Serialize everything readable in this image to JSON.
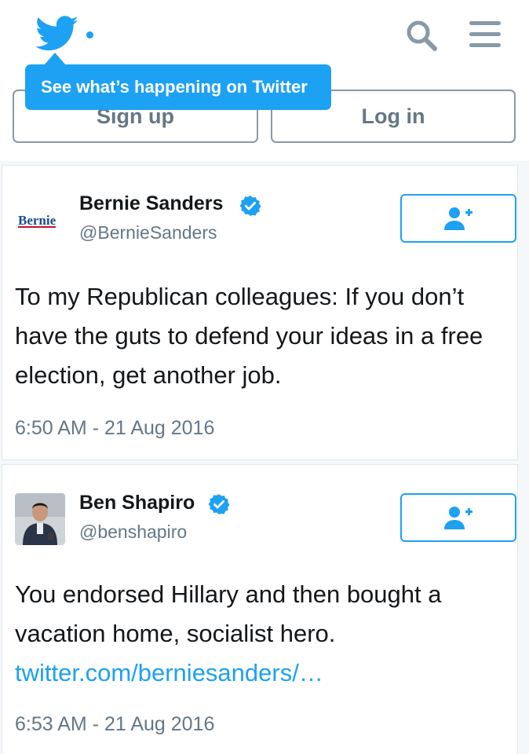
{
  "header": {
    "logo_icon": "twitter-bird-icon",
    "search_icon": "search-icon",
    "menu_icon": "hamburger-menu-icon",
    "accent_color": "#1da1f2"
  },
  "tooltip": {
    "text": "See what’s happening on Twitter"
  },
  "auth": {
    "signup_label": "Sign up",
    "login_label": "Log in"
  },
  "tweets": [
    {
      "display_name": "Bernie Sanders",
      "handle": "@BernieSanders",
      "avatar_text": "Bernie",
      "verified": true,
      "follow_icon": "follow-user-plus-icon",
      "text": "To my Republican colleagues: If you don’t have the guts to defend your ideas in a free election, get another job.",
      "timestamp": "6:50 AM - 21 Aug 2016"
    },
    {
      "display_name": "Ben Shapiro",
      "handle": "@benshapiro",
      "avatar_icon": "profile-photo",
      "verified": true,
      "follow_icon": "follow-user-plus-icon",
      "text": "You endorsed Hillary and then bought a vacation home, socialist hero.",
      "link": "twitter.com/berniesanders/…",
      "timestamp": "6:53 AM - 21 Aug 2016"
    }
  ]
}
